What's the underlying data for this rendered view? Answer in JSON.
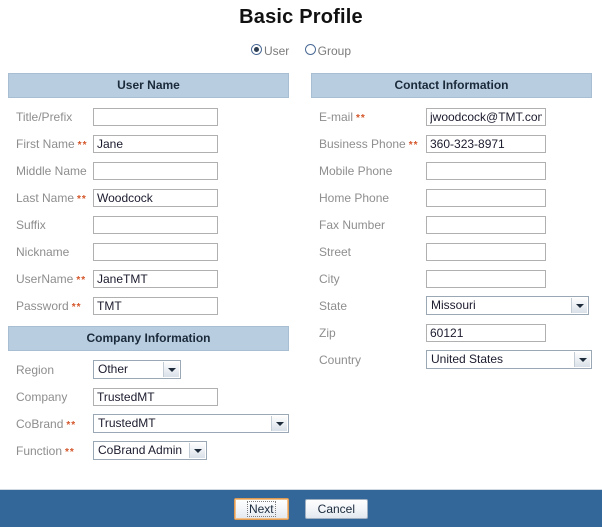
{
  "page": {
    "title": "Basic Profile"
  },
  "entity_type": {
    "options": [
      {
        "label": "User",
        "selected": true
      },
      {
        "label": "Group",
        "selected": false
      }
    ]
  },
  "sections": {
    "user_name": {
      "header": "User Name",
      "fields": [
        {
          "label": "Title/Prefix",
          "required": false,
          "type": "text",
          "value": "",
          "placeholder": ""
        },
        {
          "label": "First Name",
          "required": true,
          "type": "text",
          "value": "Jane",
          "placeholder": ""
        },
        {
          "label": "Middle Name",
          "required": false,
          "type": "text",
          "value": "",
          "placeholder": ""
        },
        {
          "label": "Last Name",
          "required": true,
          "type": "text",
          "value": "Woodcock",
          "placeholder": ""
        },
        {
          "label": "Suffix",
          "required": false,
          "type": "text",
          "value": "",
          "placeholder": ""
        },
        {
          "label": "Nickname",
          "required": false,
          "type": "text",
          "value": "",
          "placeholder": ""
        },
        {
          "label": "UserName",
          "required": true,
          "type": "text",
          "value": "JaneTMT",
          "placeholder": ""
        },
        {
          "label": "Password",
          "required": true,
          "type": "text",
          "value": "TMT",
          "placeholder": ""
        }
      ]
    },
    "company_information": {
      "header": "Company Information",
      "fields": [
        {
          "label": "Region",
          "required": false,
          "type": "select",
          "value": "Other"
        },
        {
          "label": "Company",
          "required": false,
          "type": "text",
          "value": "TrustedMT",
          "placeholder": ""
        },
        {
          "label": "CoBrand",
          "required": true,
          "type": "select",
          "value": "TrustedMT"
        },
        {
          "label": "Function",
          "required": true,
          "type": "select",
          "value": "CoBrand Admin"
        }
      ]
    },
    "contact_information": {
      "header": "Contact Information",
      "fields": [
        {
          "label": "E-mail",
          "required": true,
          "type": "text",
          "value": "jwoodcock@TMT.com",
          "placeholder": ""
        },
        {
          "label": "Business Phone",
          "required": true,
          "type": "text",
          "value": "360-323-8971",
          "placeholder": ""
        },
        {
          "label": "Mobile Phone",
          "required": false,
          "type": "text",
          "value": "",
          "placeholder": ""
        },
        {
          "label": "Home Phone",
          "required": false,
          "type": "text",
          "value": "",
          "placeholder": ""
        },
        {
          "label": "Fax Number",
          "required": false,
          "type": "text",
          "value": "",
          "placeholder": ""
        },
        {
          "label": "Street",
          "required": false,
          "type": "text",
          "value": "",
          "placeholder": ""
        },
        {
          "label": "City",
          "required": false,
          "type": "text",
          "value": "",
          "placeholder": ""
        },
        {
          "label": "State",
          "required": false,
          "type": "select",
          "value": "Missouri"
        },
        {
          "label": "Zip",
          "required": false,
          "type": "text",
          "value": "60121",
          "placeholder": ""
        },
        {
          "label": "Country",
          "required": false,
          "type": "select",
          "value": "United States"
        }
      ]
    }
  },
  "required_marker": "**",
  "footer": {
    "next_label": "Next",
    "cancel_label": "Cancel"
  },
  "colors": {
    "section_header_bg": "#b9cde0",
    "footer_bg": "#336699",
    "required_marker": "#d4562a",
    "focus_border": "#e09b53",
    "label_text": "#8e8e8e"
  }
}
